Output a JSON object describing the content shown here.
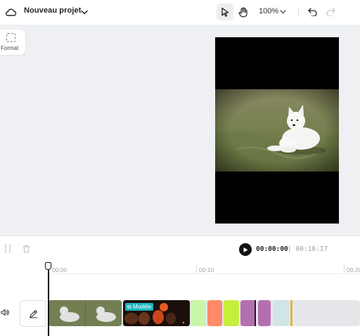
{
  "header": {
    "cloud_icon": "cloud-icon",
    "project_name": "Nouveau projet",
    "zoom": "100%"
  },
  "sidebar": {
    "format_label": "Format"
  },
  "playback": {
    "current_time": "00:00:00",
    "total_time": "| 00:16:17"
  },
  "ruler": {
    "ticks": [
      "00:00",
      "00:10",
      "00:20"
    ]
  },
  "track": {
    "template_badge": "Modèle",
    "clip_colors": [
      "#c8f7a8",
      "#ff8a6a",
      "#c6ef3c",
      "#b46fae",
      "#b46fae",
      "#cfe5e6"
    ],
    "end_marker_color": "#e2b53a"
  },
  "colors": {
    "accent_teal": "#19b4bf",
    "canvas_bg": "#eef0f3"
  }
}
